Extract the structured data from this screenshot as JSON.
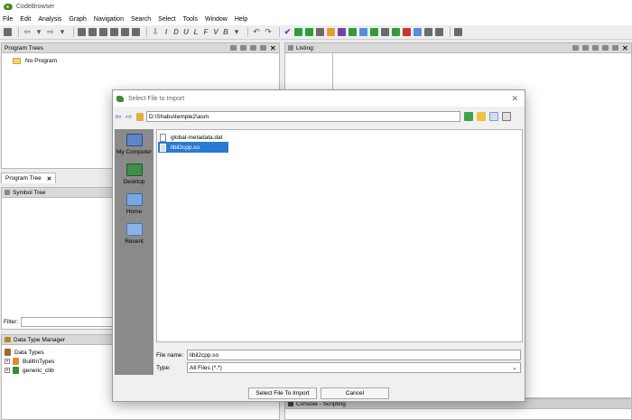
{
  "window": {
    "title": "CodeBrowser"
  },
  "menu": [
    "File",
    "Edit",
    "Analysis",
    "Graph",
    "Navigation",
    "Search",
    "Select",
    "Tools",
    "Window",
    "Help"
  ],
  "toolbar": {
    "glyphs": [
      "I",
      "D",
      "U",
      "L",
      "F",
      "V",
      "B"
    ],
    "icons": [
      "save-icon",
      "back-icon",
      "forward-icon",
      "navigate-icon",
      "undo-icon",
      "redo-icon",
      "check-icon",
      "debug-icon",
      "run-icon",
      "script-icon",
      "memory-icon",
      "bookmark-icon",
      "console-icon",
      "home-icon",
      "options-icon"
    ]
  },
  "program_trees": {
    "title": "Program Trees",
    "root": "No Program",
    "tab_label": "Program Tree"
  },
  "symbol_tree": {
    "title": "Symbol Tree"
  },
  "filter": {
    "label": "Filter:"
  },
  "data_type_manager": {
    "title": "Data Type Manager",
    "root": "Data Types",
    "items": [
      "BuiltInTypes",
      "generic_clib"
    ]
  },
  "listing": {
    "title": "Listing:"
  },
  "console": {
    "title": "Console - Scripting"
  },
  "dialog": {
    "title": "Select File to Import",
    "path": "D:\\Shabu\\temple2\\asm",
    "places": [
      "My Computer",
      "Desktop",
      "Home",
      "Recent"
    ],
    "files": [
      "global-metadata.dat",
      "libil2cpp.so"
    ],
    "selected_file": "libil2cpp.so",
    "file_name_label": "File name:",
    "file_name_value": "libil2cpp.so",
    "type_label": "Type:",
    "type_value": "All Files (*.*)",
    "ok_label": "Select File To Import",
    "cancel_label": "Cancel"
  }
}
